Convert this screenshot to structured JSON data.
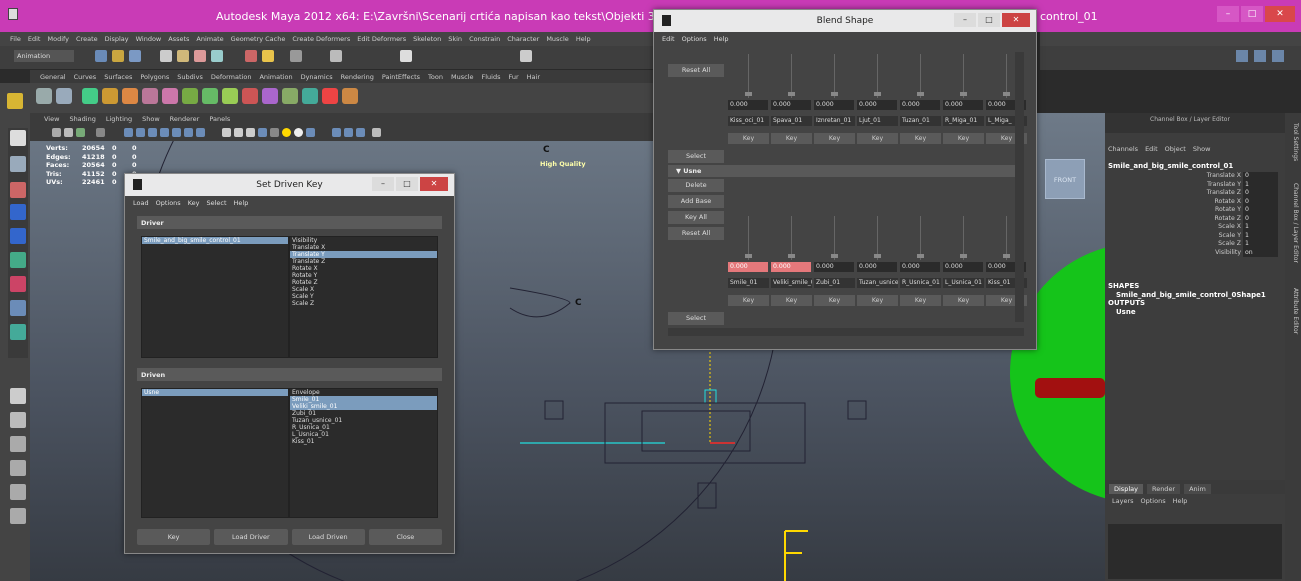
{
  "maya": {
    "title": "Autodesk Maya 2012 x64: E:\\Završni\\Scenarij crtića napisan kao tekst\\Objekti 3D za završni\\Glavn",
    "title_right": "control_01",
    "menus": [
      "File",
      "Edit",
      "Modify",
      "Create",
      "Display",
      "Window",
      "Assets",
      "Animate",
      "Geometry Cache",
      "Create Deformers",
      "Edit Deformers",
      "Skeleton",
      "Skin",
      "Constrain",
      "Character",
      "Muscle",
      "Help"
    ],
    "mode": "Animation",
    "shelf_tabs": [
      "General",
      "Curves",
      "Surfaces",
      "Polygons",
      "Subdivs",
      "Deformation",
      "Animation",
      "Dynamics",
      "Rendering",
      "PaintEffects",
      "Toon",
      "Muscle",
      "Fluids",
      "Fur",
      "Hair"
    ],
    "panel_menus": [
      "View",
      "Shading",
      "Lighting",
      "Show",
      "Renderer",
      "Panels"
    ],
    "hud": [
      {
        "label": "Verts:",
        "v1": "20654",
        "v2": "0",
        "v3": "0"
      },
      {
        "label": "Edges:",
        "v1": "41218",
        "v2": "0",
        "v3": "0"
      },
      {
        "label": "Faces:",
        "v1": "20564",
        "v2": "0",
        "v3": "0"
      },
      {
        "label": "Tris:",
        "v1": "41152",
        "v2": "0",
        "v3": "0"
      },
      {
        "label": "UVs:",
        "v1": "22461",
        "v2": "0",
        "v3": "0"
      }
    ],
    "high_quality": "High Quality",
    "view_label": "FRONT",
    "curve_label_top": "C",
    "curve_label_mid": "C",
    "letter_f": "F",
    "window_buttons": {
      "min": "–",
      "max": "□",
      "close": "✕"
    }
  },
  "channel_box": {
    "header": "Channel Box / Layer Editor",
    "menus": [
      "Channels",
      "Edit",
      "Object",
      "Show"
    ],
    "object": "Smile_and_big_smile_control_01",
    "attrs": [
      {
        "name": "Translate X",
        "value": "0"
      },
      {
        "name": "Translate Y",
        "value": "1"
      },
      {
        "name": "Translate Z",
        "value": "0"
      },
      {
        "name": "Rotate X",
        "value": "0"
      },
      {
        "name": "Rotate Y",
        "value": "0"
      },
      {
        "name": "Rotate Z",
        "value": "0"
      },
      {
        "name": "Scale X",
        "value": "1"
      },
      {
        "name": "Scale Y",
        "value": "1"
      },
      {
        "name": "Scale Z",
        "value": "1"
      },
      {
        "name": "Visibility",
        "value": "on"
      }
    ],
    "shapes_label": "SHAPES",
    "shape": "Smile_and_big_smile_control_0Shape1",
    "outputs_label": "OUTPUTS",
    "output": "Usne",
    "layer_tabs": [
      "Display",
      "Render",
      "Anim"
    ],
    "layer_menus": [
      "Layers",
      "Options",
      "Help"
    ],
    "side_tabs": [
      "Tool Settings",
      "Channel Box / Layer Editor",
      "Attribute Editor"
    ]
  },
  "sdk": {
    "title": "Set Driven Key",
    "menus": [
      "Load",
      "Options",
      "Key",
      "Select",
      "Help"
    ],
    "driver_label": "Driver",
    "driver_obj": "Smile_and_big_smile_control_01",
    "driver_attrs": [
      "Visibility",
      "Translate X",
      "Translate Y",
      "Translate Z",
      "Rotate X",
      "Rotate Y",
      "Rotate Z",
      "Scale X",
      "Scale Y",
      "Scale Z"
    ],
    "driven_label": "Driven",
    "driven_obj": "Usne",
    "driven_attrs": [
      "Envelope",
      "Smile_01",
      "Veliki_smile_01",
      "Zubi_01",
      "Tuzan_usnice_01",
      "R_Usnica_01",
      "L_Usnica_01",
      "Kiss_01"
    ],
    "buttons": [
      "Key",
      "Load Driver",
      "Load Driven",
      "Close"
    ]
  },
  "bs": {
    "title": "Blend Shape",
    "menus": [
      "Edit",
      "Options",
      "Help"
    ],
    "top_left_buttons": [
      "Reset All",
      "Select"
    ],
    "top_values": [
      "0.000",
      "0.000",
      "0.000",
      "0.000",
      "0.000",
      "0.000",
      "0.000"
    ],
    "top_names": [
      "Kiss_oci_01",
      "Spava_01",
      "Iznretan_01",
      "Ljut_01",
      "Tuzan_01",
      "R_Miga_01",
      "L_Miga_"
    ],
    "section": "▼ Usne",
    "left_buttons": [
      "Delete",
      "Add Base",
      "Key All",
      "Reset All",
      "Select"
    ],
    "bot_values": [
      "0.000",
      "0.000",
      "0.000",
      "0.000",
      "0.000",
      "0.000",
      "0.000"
    ],
    "bot_names": [
      "Smile_01",
      "Veliki_smile_01",
      "Zubi_01",
      "Tuzan_usnice_01",
      "R_Usnica_01",
      "L_Usnica_01",
      "Kiss_01"
    ],
    "key_label": "Key"
  }
}
